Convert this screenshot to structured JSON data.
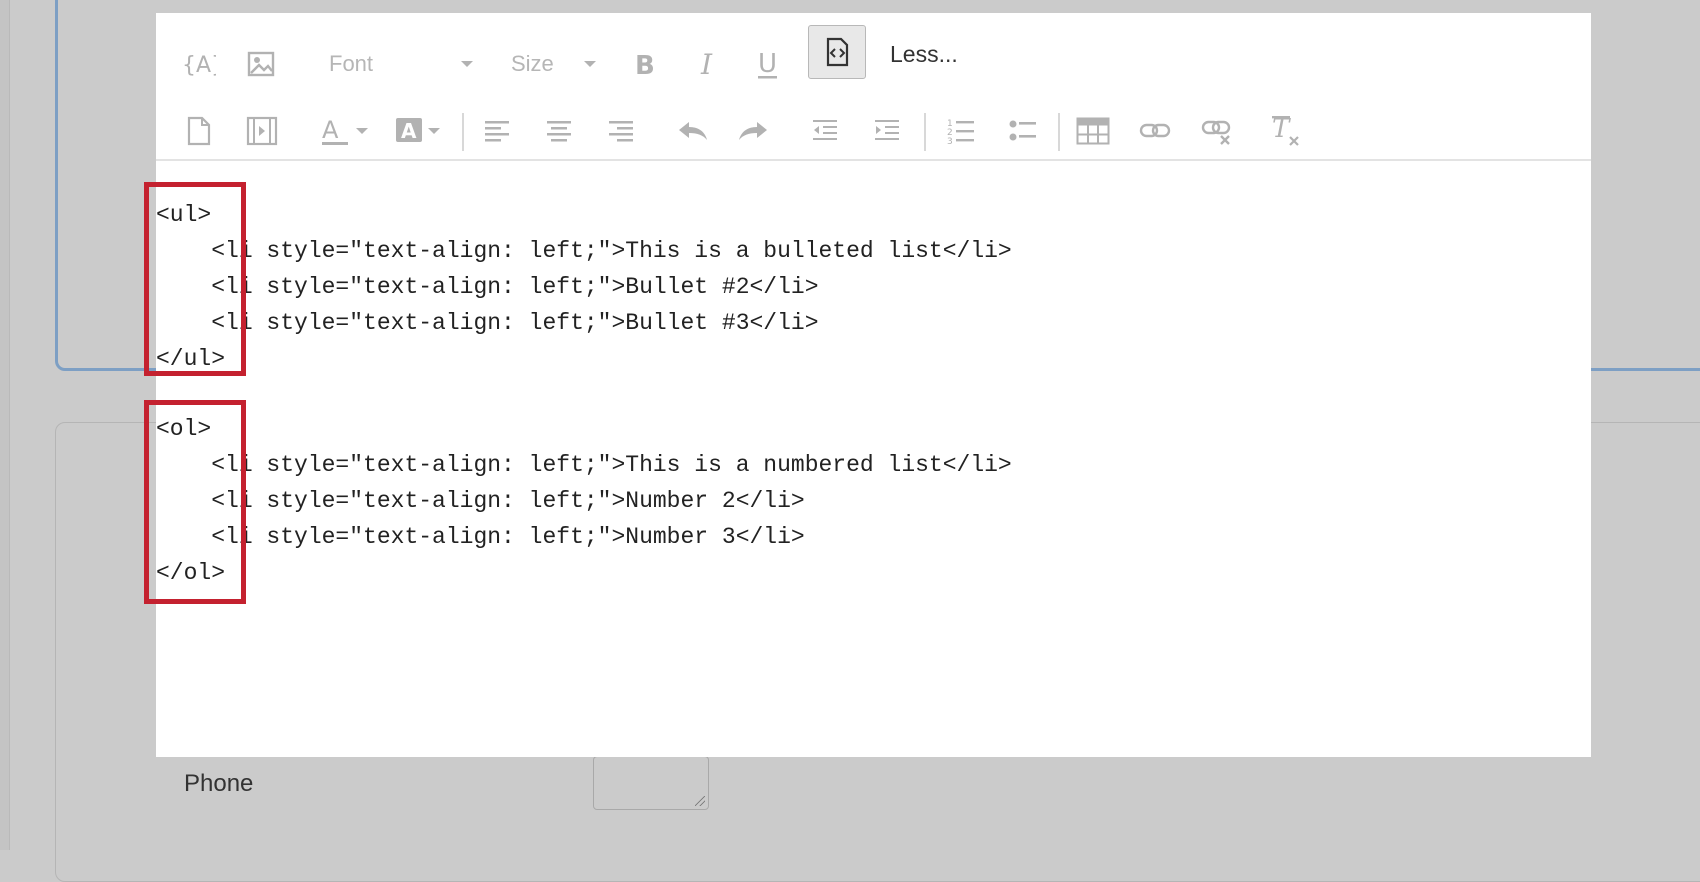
{
  "toolbar": {
    "row1": {
      "piped_text_icon": "piped-text-icon",
      "image_icon": "image-icon",
      "font_label": "Font",
      "size_label": "Size",
      "bold_icon": "bold-icon",
      "italic_icon": "italic-icon",
      "underline_icon": "underline-icon",
      "source_icon": "source-code-icon",
      "less_label": "Less..."
    },
    "row2": [
      "document-icon",
      "media-icon",
      "text-color-icon",
      "background-color-icon",
      "align-left-icon",
      "align-center-icon",
      "align-right-icon",
      "undo-icon",
      "redo-icon",
      "outdent-icon",
      "indent-icon",
      "numbered-list-icon",
      "bulleted-list-icon",
      "table-icon",
      "link-icon",
      "unlink-icon",
      "clear-formatting-icon"
    ]
  },
  "code_lines": [
    "<ul>",
    "    <li style=\"text-align: left;\">This is a bulleted list</li>",
    "    <li style=\"text-align: left;\">Bullet #2</li>",
    "    <li style=\"text-align: left;\">Bullet #3</li>",
    "</ul>",
    "",
    "<ol>",
    "    <li style=\"text-align: left;\">This is a numbered list</li>",
    "    <li style=\"text-align: left;\">Number 2</li>",
    "    <li style=\"text-align: left;\">Number 3</li>",
    "</ol>"
  ],
  "form": {
    "phone_label": "Phone",
    "phone_value": ""
  },
  "colors": {
    "highlight": "#c4212f",
    "card_border": "#7d9fc4",
    "background": "#cbcbcb"
  }
}
